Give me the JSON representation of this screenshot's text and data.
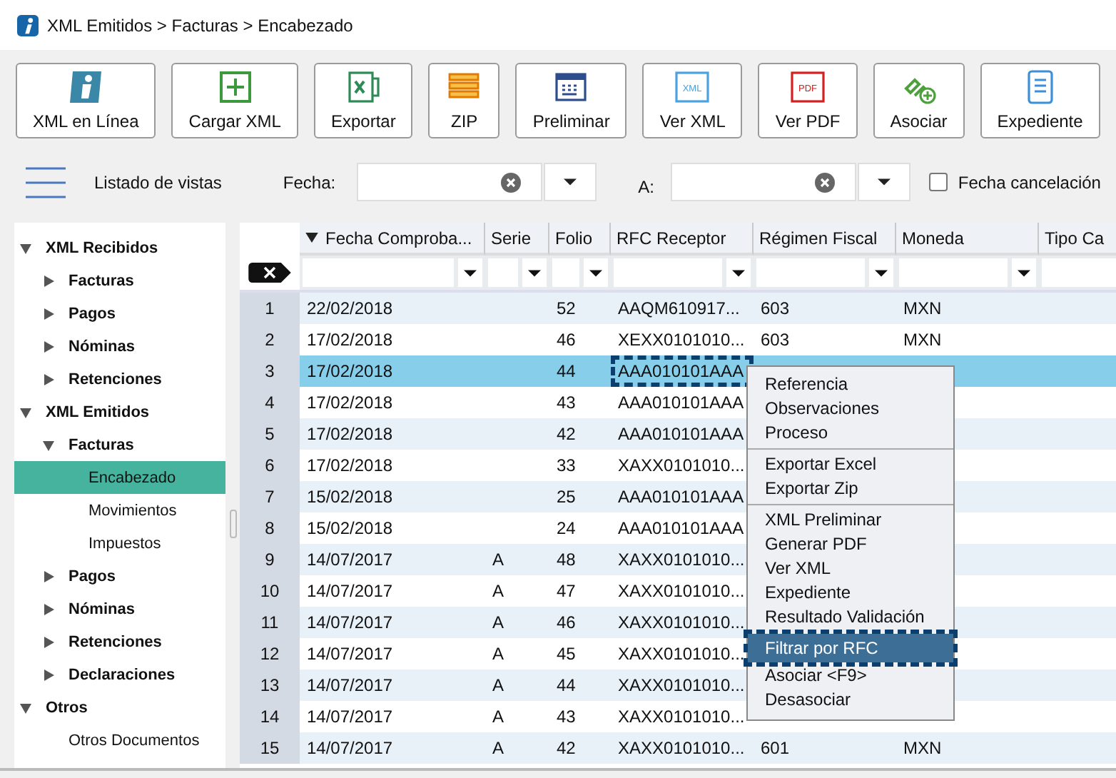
{
  "window": {
    "title": "XML Emitidos > Facturas > Encabezado"
  },
  "toolbar": [
    {
      "label": "XML en Línea",
      "kind": "info"
    },
    {
      "label": "Cargar XML",
      "kind": "add"
    },
    {
      "label": "Exportar",
      "kind": "excel"
    },
    {
      "label": "ZIP",
      "kind": "zip"
    },
    {
      "label": "Preliminar",
      "kind": "preview"
    },
    {
      "label": "Ver XML",
      "kind": "doc",
      "icon_text": "XML"
    },
    {
      "label": "Ver PDF",
      "kind": "pdf",
      "icon_text": "PDF"
    },
    {
      "label": "Asociar",
      "kind": "link"
    },
    {
      "label": "Expediente",
      "kind": "file"
    }
  ],
  "filters": {
    "views_label": "Listado de vistas",
    "from_label": "Fecha:",
    "to_label": "A:",
    "cancel_checkbox": {
      "label": "Fecha cancelación",
      "checked": false
    }
  },
  "sidebar": {
    "items": [
      {
        "label": "XML Recibidos",
        "expanded": true,
        "selected": false,
        "children": [
          {
            "label": "Facturas",
            "expanded": false,
            "selected": false
          },
          {
            "label": "Pagos",
            "expanded": false,
            "selected": false
          },
          {
            "label": "Nóminas",
            "expanded": false,
            "selected": false
          },
          {
            "label": "Retenciones",
            "expanded": false,
            "selected": false
          }
        ]
      },
      {
        "label": "XML Emitidos",
        "expanded": true,
        "selected": false,
        "children": [
          {
            "label": "Facturas",
            "expanded": true,
            "selected": false,
            "children": [
              {
                "label": "Encabezado",
                "selected": true
              },
              {
                "label": "Movimientos",
                "selected": false
              },
              {
                "label": "Impuestos",
                "selected": false
              }
            ]
          },
          {
            "label": "Pagos",
            "expanded": false,
            "selected": false
          },
          {
            "label": "Nóminas",
            "expanded": false,
            "selected": false
          },
          {
            "label": "Retenciones",
            "expanded": false,
            "selected": false
          },
          {
            "label": "Declaraciones",
            "expanded": false,
            "selected": false
          }
        ]
      },
      {
        "label": "Otros",
        "expanded": true,
        "selected": false,
        "children": [
          {
            "label": "Otros Documentos",
            "selected": false
          }
        ]
      }
    ]
  },
  "table": {
    "columns": [
      {
        "label": "Fecha Comproba...",
        "sorted": true
      },
      {
        "label": "Serie",
        "sorted": false
      },
      {
        "label": "Folio",
        "sorted": false
      },
      {
        "label": "RFC Receptor",
        "sorted": false
      },
      {
        "label": "Régimen Fiscal",
        "sorted": false
      },
      {
        "label": "Moneda",
        "sorted": false
      },
      {
        "label": "Tipo Ca",
        "sorted": false
      }
    ],
    "rows": [
      {
        "number": "1",
        "selected": false,
        "focused": false,
        "cells": [
          "22/02/2018",
          null,
          "52",
          "AAQM610917...",
          "603",
          "MXN"
        ]
      },
      {
        "number": "2",
        "selected": false,
        "focused": false,
        "cells": [
          "17/02/2018",
          null,
          "46",
          "XEXX0101010...",
          "603",
          "MXN"
        ]
      },
      {
        "number": "3",
        "selected": true,
        "focused": true,
        "cells": [
          "17/02/2018",
          null,
          "44",
          "AAA010101AAA"
        ]
      },
      {
        "number": "4",
        "selected": false,
        "focused": false,
        "cells": [
          "17/02/2018",
          null,
          "43",
          "AAA010101AAA"
        ]
      },
      {
        "number": "5",
        "selected": false,
        "focused": false,
        "cells": [
          "17/02/2018",
          null,
          "42",
          "AAA010101AAA"
        ]
      },
      {
        "number": "6",
        "selected": false,
        "focused": false,
        "cells": [
          "17/02/2018",
          null,
          "33",
          "XAXX0101010..."
        ]
      },
      {
        "number": "7",
        "selected": false,
        "focused": false,
        "cells": [
          "15/02/2018",
          null,
          "25",
          "AAA010101AAA"
        ]
      },
      {
        "number": "8",
        "selected": false,
        "focused": false,
        "cells": [
          "15/02/2018",
          null,
          "24",
          "AAA010101AAA"
        ]
      },
      {
        "number": "9",
        "selected": false,
        "focused": false,
        "cells": [
          "14/07/2017",
          "A",
          "48",
          "XAXX0101010..."
        ]
      },
      {
        "number": "10",
        "selected": false,
        "focused": false,
        "cells": [
          "14/07/2017",
          "A",
          "47",
          "XAXX0101010..."
        ]
      },
      {
        "number": "11",
        "selected": false,
        "focused": false,
        "cells": [
          "14/07/2017",
          "A",
          "46",
          "XAXX0101010..."
        ]
      },
      {
        "number": "12",
        "selected": false,
        "focused": false,
        "cells": [
          "14/07/2017",
          "A",
          "45",
          "XAXX0101010..."
        ]
      },
      {
        "number": "13",
        "selected": false,
        "focused": false,
        "cells": [
          "14/07/2017",
          "A",
          "44",
          "XAXX0101010..."
        ]
      },
      {
        "number": "14",
        "selected": false,
        "focused": false,
        "cells": [
          "14/07/2017",
          "A",
          "43",
          "XAXX0101010..."
        ]
      },
      {
        "number": "15",
        "selected": false,
        "focused": false,
        "cells": [
          "14/07/2017",
          "A",
          "42",
          "XAXX0101010...",
          "601",
          "MXN"
        ]
      }
    ]
  },
  "context_menu": {
    "groups": [
      [
        {
          "label": "Referencia",
          "selected": false
        },
        {
          "label": "Observaciones",
          "selected": false
        },
        {
          "label": "Proceso",
          "selected": false
        }
      ],
      [
        {
          "label": "Exportar Excel",
          "selected": false
        },
        {
          "label": "Exportar Zip",
          "selected": false
        }
      ],
      [
        {
          "label": "XML Preliminar",
          "selected": false
        },
        {
          "label": "Generar PDF",
          "selected": false
        },
        {
          "label": "Ver XML",
          "selected": false
        },
        {
          "label": "Expediente",
          "selected": false
        },
        {
          "label": "Resultado Validación",
          "selected": false
        },
        {
          "label": "Filtrar por RFC",
          "selected": true
        },
        {
          "label": "Asociar <F9>",
          "selected": false
        },
        {
          "label": "Desasociar",
          "selected": false
        }
      ]
    ]
  }
}
